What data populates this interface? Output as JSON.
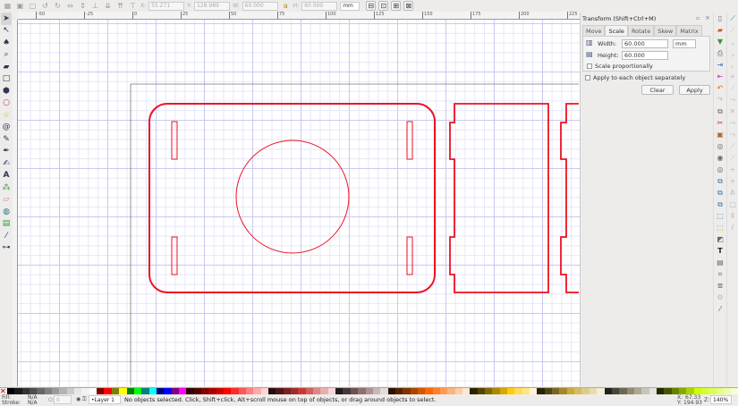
{
  "toolbar": {
    "x_label": "X:",
    "x_value": "55.271",
    "y_label": "Y:",
    "y_value": "128.989",
    "w_label": "W:",
    "w_value": "60.000",
    "h_label": "H:",
    "h_value": "60.000",
    "unit": "mm"
  },
  "ruler": {
    "labels": [
      "-50",
      "-25",
      "0",
      "25",
      "50",
      "75",
      "100",
      "125",
      "150",
      "175",
      "200",
      "225"
    ]
  },
  "dialog": {
    "title": "Transform (Shift+Ctrl+M)",
    "tabs": [
      "Move",
      "Scale",
      "Rotate",
      "Skew",
      "Matrix"
    ],
    "active_tab": "Scale",
    "width_label": "Width:",
    "width_value": "60.000",
    "height_label": "Height:",
    "height_value": "60.000",
    "unit": "mm",
    "scale_prop": "Scale proportionally",
    "apply_each": "Apply to each object separately",
    "clear": "Clear",
    "apply": "Apply"
  },
  "status": {
    "fill_label": "Fill:",
    "fill_value": "N/A",
    "stroke_label": "Stroke:",
    "stroke_value": "N/A",
    "opacity_label": "O:",
    "opacity_value": "0",
    "layer": "•Layer 1",
    "message": "No objects selected. Click, Shift+click, Alt+scroll mouse on top of objects, or drag around objects to select.",
    "x_label": "X:",
    "x_value": "67.33",
    "y_label": "Y:",
    "y_value": "194.93",
    "zoom_label": "Z:",
    "zoom_value": "140%"
  },
  "colors": {
    "stroke": "#ee1122",
    "palette": [
      "#000000",
      "#1a1a1a",
      "#333333",
      "#4d4d4d",
      "#666666",
      "#808080",
      "#999999",
      "#b3b3b3",
      "#cccccc",
      "#e6e6e6",
      "#f2f2f2",
      "#ffffff",
      "#800000",
      "#ff0000",
      "#808000",
      "#ffff00",
      "#008000",
      "#00ff00",
      "#008080",
      "#00ffff",
      "#000080",
      "#0000ff",
      "#800080",
      "#ff00ff",
      "#2b0000",
      "#550000",
      "#800000",
      "#aa0000",
      "#d40000",
      "#ff0000",
      "#ff2a2a",
      "#ff5555",
      "#ff8080",
      "#ffaaaa",
      "#ffd5d5",
      "#280b0b",
      "#501616",
      "#782121",
      "#a02c2c",
      "#c83737",
      "#d35f5f",
      "#de8787",
      "#e9afaf",
      "#f4d7d7",
      "#241c1c",
      "#483737",
      "#6c5353",
      "#916f6f",
      "#ac9393",
      "#c8b7b7",
      "#e3dbdb",
      "#2b1100",
      "#552200",
      "#803300",
      "#aa4400",
      "#d45500",
      "#ff6600",
      "#ff7f2a",
      "#ff9955",
      "#ffb380",
      "#ffccaa",
      "#ffe6d5",
      "#2b2200",
      "#554400",
      "#806600",
      "#aa8800",
      "#d4aa00",
      "#ffcc00",
      "#ffdd55",
      "#ffe680",
      "#fff6d5",
      "#28220b",
      "#504416",
      "#786721",
      "#a0892c",
      "#c8ab37",
      "#d3bc5f",
      "#decd87",
      "#e9ddaf",
      "#f4eed7",
      "#24221c",
      "#484537",
      "#6c6753",
      "#918a6f",
      "#aca793",
      "#c8c4b7",
      "#e3e2db",
      "#222b00",
      "#445500",
      "#668000",
      "#88aa00",
      "#aad400",
      "#ccff00",
      "#d4ff2a",
      "#ddff55",
      "#e5ff80",
      "#eeffaa",
      "#f6ffd5"
    ]
  }
}
